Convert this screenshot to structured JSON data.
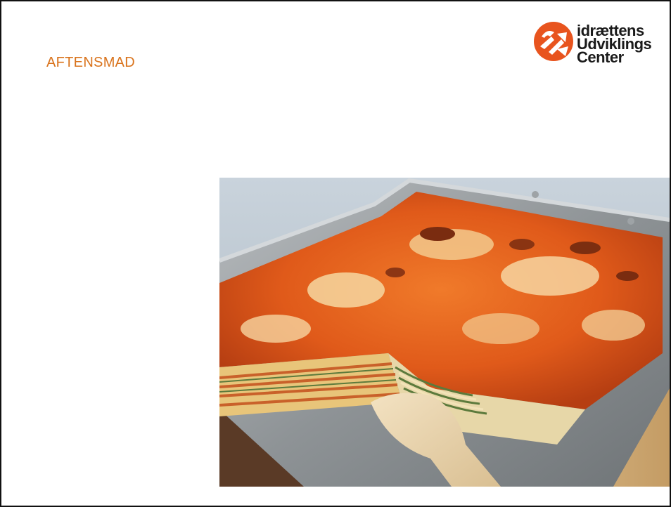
{
  "slide": {
    "title": "AFTENSMAD",
    "title_color": "#d9731c"
  },
  "logo": {
    "line1": "idrættens",
    "line2": "Udviklings",
    "line3": "Center",
    "mark_color": "#e8541e",
    "icon": "arrows-logo-icon"
  },
  "photo": {
    "icon": "lasagna-dish-image"
  }
}
